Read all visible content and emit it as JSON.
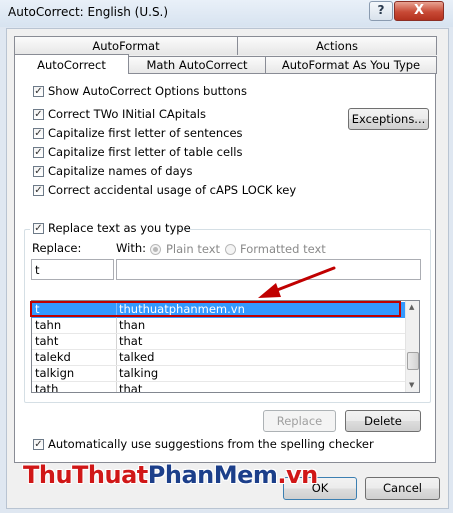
{
  "window": {
    "title": "AutoCorrect: English (U.S.)",
    "help_label": "?",
    "close_label": "X"
  },
  "tabs": {
    "top_row": [
      "AutoFormat",
      "Actions"
    ],
    "bottom_row": [
      "AutoCorrect",
      "Math AutoCorrect",
      "AutoFormat As You Type"
    ]
  },
  "options": {
    "show_buttons": "Show AutoCorrect Options buttons",
    "two_initial_caps": "Correct TWo INitial CApitals",
    "cap_sentences": "Capitalize first letter of sentences",
    "cap_table_cells": "Capitalize first letter of table cells",
    "cap_days": "Capitalize names of days",
    "caps_lock": "Correct accidental usage of cAPS LOCK key",
    "exceptions_label": "Exceptions...",
    "replace_as_you_type": "Replace text as you type"
  },
  "replace_section": {
    "replace_label": "Replace:",
    "with_label": "With:",
    "plain_text": "Plain text",
    "formatted_text": "Formatted text",
    "replace_value": "t",
    "with_value": ""
  },
  "entries": [
    {
      "from": "t",
      "to": "thuthuatphanmem.vn",
      "selected": true
    },
    {
      "from": "tahn",
      "to": "than"
    },
    {
      "from": "taht",
      "to": "that"
    },
    {
      "from": "talekd",
      "to": "talked"
    },
    {
      "from": "talkign",
      "to": "talking"
    },
    {
      "from": "tath",
      "to": "that"
    }
  ],
  "actions": {
    "replace_button": "Replace",
    "delete_button": "Delete",
    "suggestions": "Automatically use suggestions from the spelling checker",
    "ok_button": "OK",
    "cancel_button": "Cancel"
  },
  "watermark": {
    "part1": "ThuThuat",
    "part2": "PhanMem",
    "part3": ".vn"
  },
  "colors": {
    "selection": "#3399ff",
    "annotation": "#c00000",
    "watermark_red": "#d01717",
    "watermark_blue": "#1c3f8a"
  }
}
